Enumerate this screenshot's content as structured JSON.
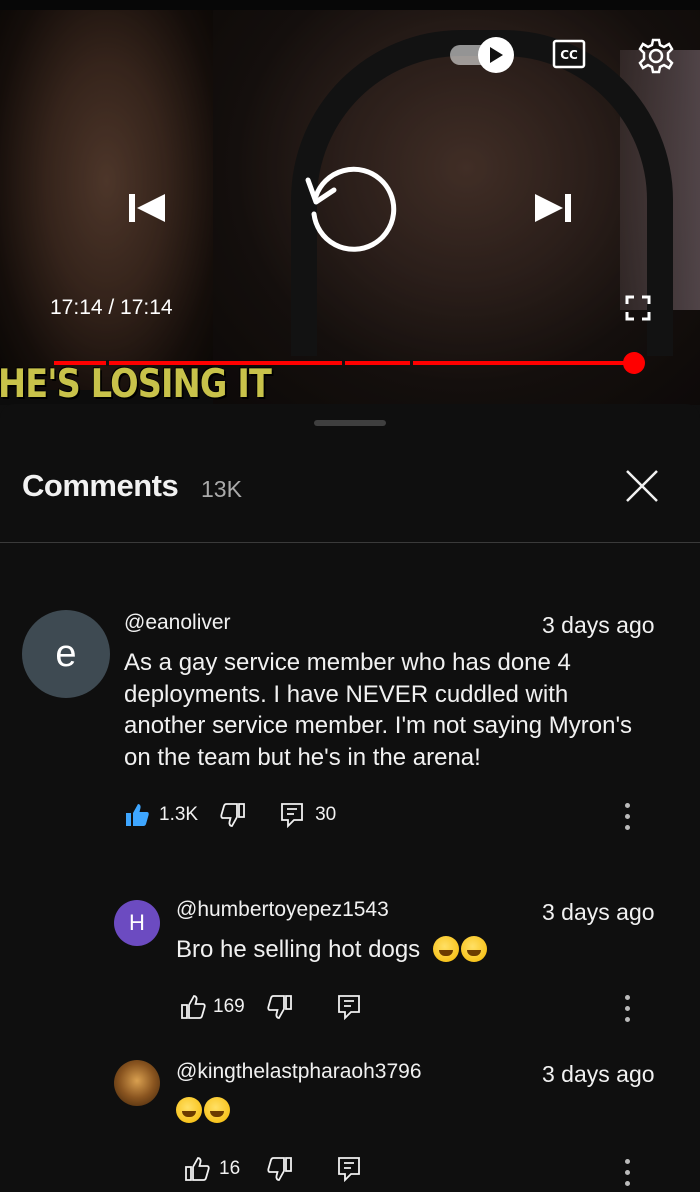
{
  "player": {
    "time_display": "17:14 / 17:14",
    "title_overlay": "HE'S LOSING IT",
    "progress": 1.0,
    "accent_color": "#ff0000",
    "icons": [
      "autoplay-toggle-icon",
      "closed-captions-icon",
      "settings-gear-icon",
      "previous-icon",
      "replay-icon",
      "next-icon",
      "fullscreen-icon"
    ]
  },
  "comments_panel": {
    "title": "Comments",
    "count": "13K",
    "close_icon": "close-icon"
  },
  "comments": [
    {
      "avatar_letter": "e",
      "avatar_color": "#3e4a52",
      "handle": "@eanoliver",
      "date": "3 days ago",
      "lines": [
        "As a gay service member who has done 4",
        "deployments. I have NEVER cuddled with",
        "another service member. I'm not saying Myron's",
        "on the team but he's in the arena!"
      ],
      "likes": "1.3K",
      "liked": true,
      "replies": "30"
    },
    {
      "avatar_letter": "H",
      "avatar_color": "#6c4bc1",
      "handle": "@humbertoyepez1543",
      "date": "3 days ago",
      "text": "Bro he selling hot dogs",
      "emojis": [
        "loudly-crying-face",
        "grinning-squinting-face"
      ],
      "likes": "169"
    },
    {
      "avatar_letter": "",
      "avatar_color": "#5a3a1a",
      "handle": "@kingthelastpharaoh3796",
      "date": "3 days ago",
      "text": "",
      "emojis": [
        "face-with-tears-of-joy",
        "rolling-on-floor-laughing"
      ],
      "likes": "16"
    }
  ]
}
